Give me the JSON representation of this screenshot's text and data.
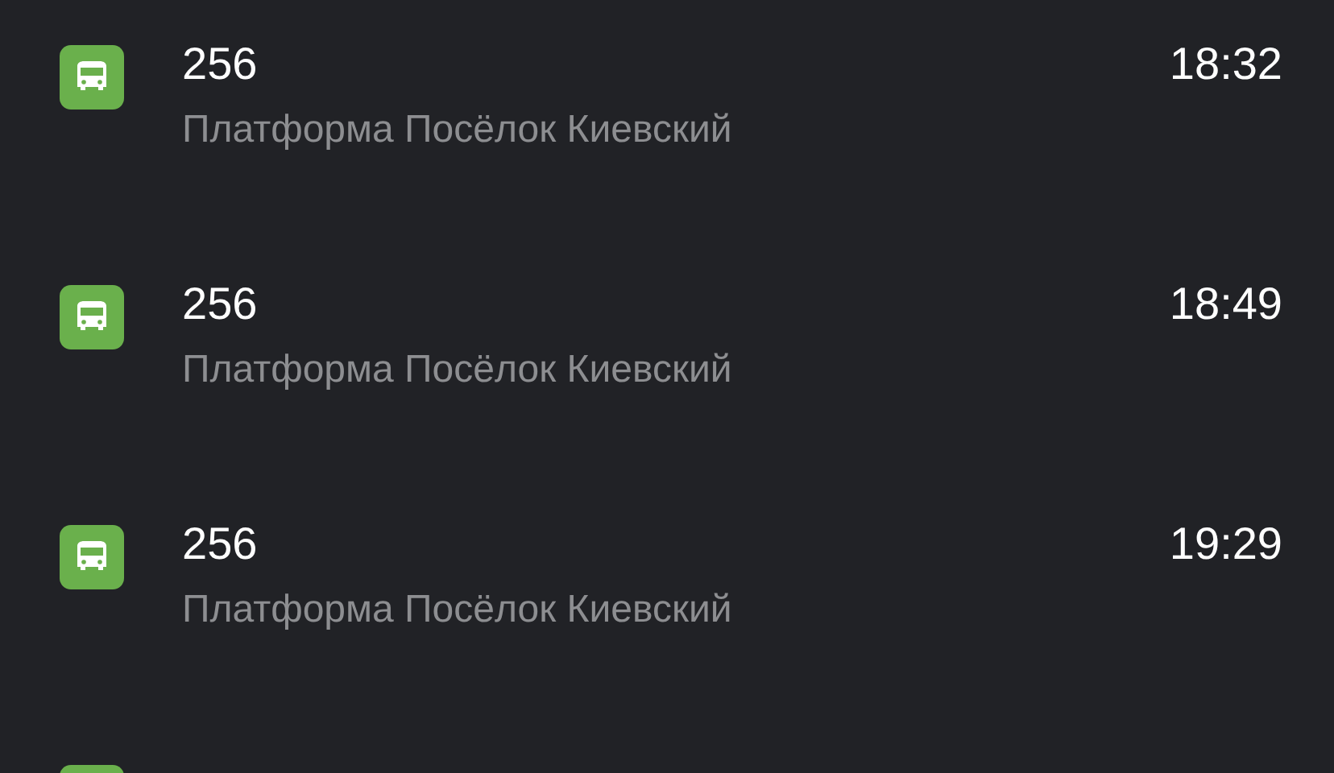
{
  "departures": [
    {
      "kind": "full",
      "route": "256",
      "stop": "Платформа Посёлок Киевский",
      "time": "18:32"
    },
    {
      "kind": "full",
      "route": "256",
      "stop": "Платформа Посёлок Киевский",
      "time": "18:49"
    },
    {
      "kind": "full",
      "route": "256",
      "stop": "Платформа Посёлок Киевский",
      "time": "19:29"
    },
    {
      "kind": "icon_only"
    }
  ]
}
